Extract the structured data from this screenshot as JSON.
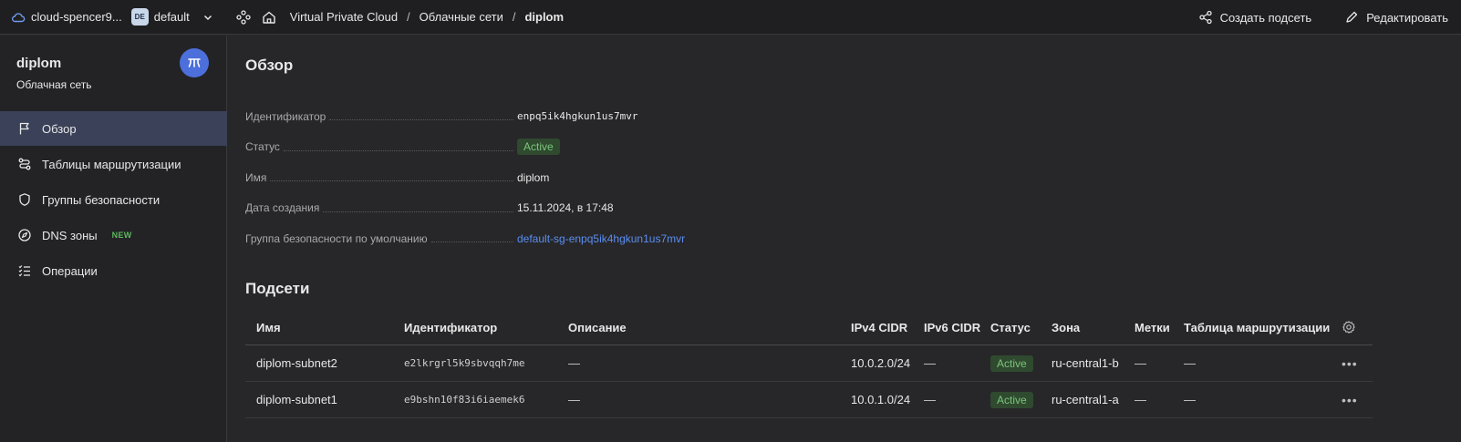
{
  "topbar": {
    "cloud_name": "cloud-spencer9...",
    "folder_badge": "DE",
    "folder_name": "default",
    "breadcrumbs": [
      "Virtual Private Cloud",
      "/",
      "Облачные сети",
      "/",
      "diplom"
    ],
    "actions": {
      "create_subnet": "Создать подсеть",
      "edit": "Редактировать"
    }
  },
  "sidebar": {
    "title": "diplom",
    "subtitle": "Облачная сеть",
    "items": [
      {
        "label": "Обзор",
        "icon": "flag-icon",
        "active": true
      },
      {
        "label": "Таблицы маршрутизации",
        "icon": "route-icon"
      },
      {
        "label": "Группы безопасности",
        "icon": "shield-icon"
      },
      {
        "label": "DNS зоны",
        "icon": "compass-icon",
        "badge": "NEW"
      },
      {
        "label": "Операции",
        "icon": "checklist-icon"
      }
    ]
  },
  "overview": {
    "heading": "Обзор",
    "id_label": "Идентификатор",
    "id_value": "enpq5ik4hgkun1us7mvr",
    "status_label": "Статус",
    "status_value": "Active",
    "name_label": "Имя",
    "name_value": "diplom",
    "created_label": "Дата создания",
    "created_value": "15.11.2024, в 17:48",
    "sg_label": "Группа безопасности по умолчанию",
    "sg_value": "default-sg-enpq5ik4hgkun1us7mvr"
  },
  "subnets": {
    "heading": "Подсети",
    "columns": {
      "name": "Имя",
      "id": "Идентификатор",
      "desc": "Описание",
      "ipv4": "IPv4 CIDR",
      "ipv6": "IPv6 CIDR",
      "status": "Статус",
      "zone": "Зона",
      "labels": "Метки",
      "rt": "Таблица маршрутизации"
    },
    "rows": [
      {
        "name": "diplom-subnet2",
        "id": "e2lkrgrl5k9sbvqqh7me",
        "desc": "—",
        "ipv4": "10.0.2.0/24",
        "ipv6": "—",
        "status": "Active",
        "zone": "ru-central1-b",
        "labels": "—",
        "rt": "—"
      },
      {
        "name": "diplom-subnet1",
        "id": "e9bshn10f83i6iaemek6",
        "desc": "—",
        "ipv4": "10.0.1.0/24",
        "ipv6": "—",
        "status": "Active",
        "zone": "ru-central1-a",
        "labels": "—",
        "rt": "—"
      }
    ]
  },
  "colors": {
    "accent": "#4c6fdb",
    "link": "#5b8def",
    "status_active": "#7cc57c",
    "background": "#27272a"
  }
}
